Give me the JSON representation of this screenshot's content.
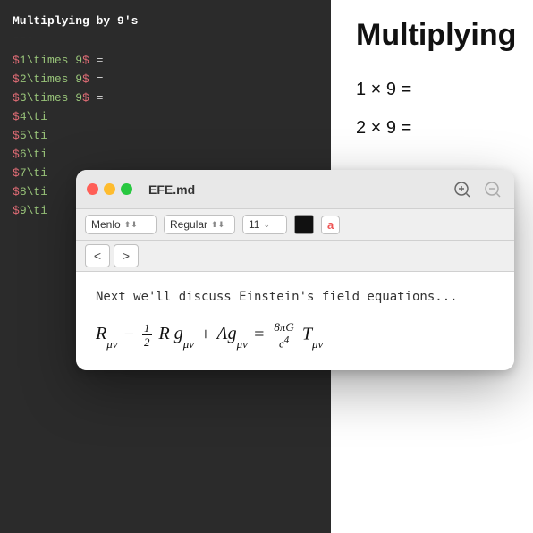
{
  "left_panel": {
    "title": "Multiplying by 9's",
    "divider": "---",
    "lines": [
      "$1\\times 9$ =",
      "$2\\times 9$ =",
      "$3\\times 9$ =",
      "$4\\ti",
      "$5\\ti",
      "$6\\ti",
      "$7\\ti",
      "$8\\ti",
      "$9\\ti"
    ]
  },
  "right_panel": {
    "title": "Multiplying",
    "math_lines": [
      "1 × 9 =",
      "2 × 9 ="
    ]
  },
  "window": {
    "title": "EFE.md",
    "traffic_lights": [
      "red",
      "yellow",
      "green"
    ],
    "font": "Menlo",
    "style": "Regular",
    "size": "11",
    "content_text": "Next we'll discuss Einstein's field equations...",
    "formula_display": "R_μν − ½ R g_μν + Λg_μν = (8πG/c⁴) T_μν",
    "nav_back": "<",
    "nav_forward": ">"
  }
}
